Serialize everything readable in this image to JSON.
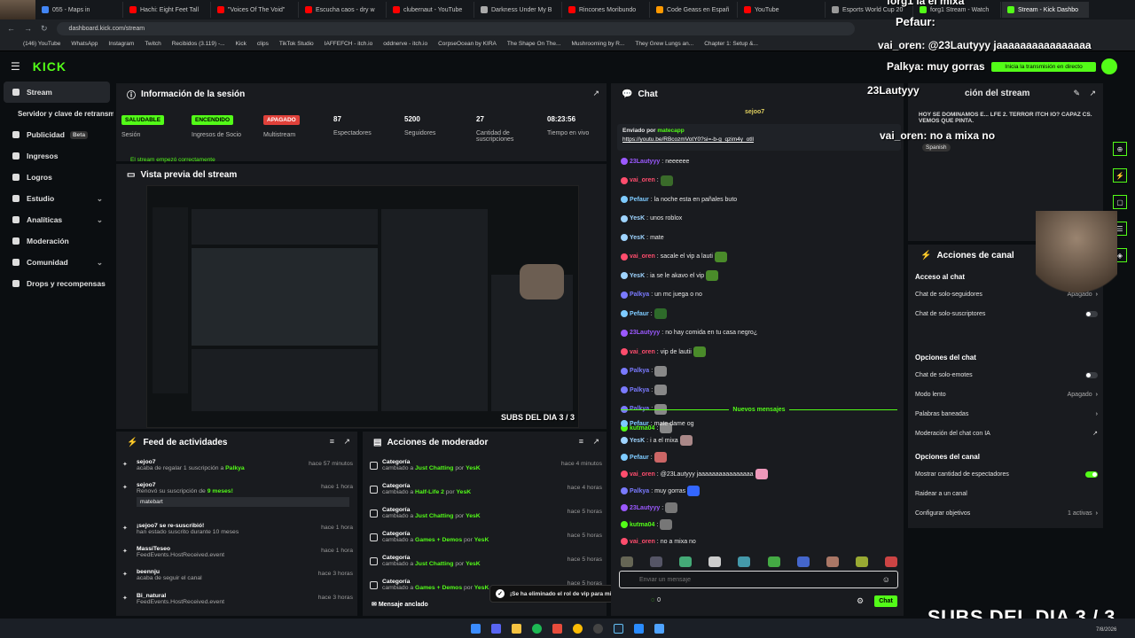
{
  "browser": {
    "tabs": [
      {
        "label": "055 - Maps in",
        "color": "#4285f4"
      },
      {
        "label": "Hachi: Eight Feet Tall",
        "color": "#f00"
      },
      {
        "label": "\"Voices Of The Void\"",
        "color": "#f00"
      },
      {
        "label": "Escucha caos - dry w",
        "color": "#f00"
      },
      {
        "label": "clubernaut - YouTube",
        "color": "#f00"
      },
      {
        "label": "Darkness Under My B",
        "color": "#aaa"
      },
      {
        "label": "Rincones Moribundo",
        "color": "#f00"
      },
      {
        "label": "Code Geass en Españ",
        "color": "#f90"
      },
      {
        "label": "YouTube",
        "color": "#f00"
      },
      {
        "label": "Esports World Cup 20",
        "color": "#999"
      },
      {
        "label": "forg1 Stream - Watch",
        "color": "#53fc18"
      },
      {
        "label": "Stream - Kick Dashbo",
        "color": "#53fc18"
      }
    ],
    "url": "dashboard.kick.com/stream",
    "bookmarks": [
      "(146) YouTube",
      "WhatsApp",
      "Instagram",
      "Twitch",
      "Recibidos (3.119) -...",
      "Kick",
      "clips",
      "TikTok Studio",
      "IAFFEFCH - itch.io",
      "oddnerve - itch.io",
      "CorpseOcean by KIRA",
      "The Shape On The...",
      "Mushrooming by R...",
      "They Grew Lungs an...",
      "Chapter 1: Setup &..."
    ]
  },
  "topnav": {
    "logo": "KICK",
    "stream_button": "Inicia la transmisión en directo"
  },
  "sidebar": [
    {
      "label": "Stream",
      "icon": "broadcast-icon",
      "active": true
    },
    {
      "label": "Servidor y clave de retransmisión",
      "icon": "",
      "active": false
    },
    {
      "label": "Publicidad",
      "icon": "megaphone-icon",
      "badge": "Beta"
    },
    {
      "label": "Ingresos",
      "icon": "dollar-icon"
    },
    {
      "label": "Logros",
      "icon": "trophy-icon"
    },
    {
      "label": "Estudio",
      "icon": "palette-icon",
      "chev": true
    },
    {
      "label": "Analíticas",
      "icon": "chart-icon",
      "chev": true
    },
    {
      "label": "Moderación",
      "icon": "shield-icon"
    },
    {
      "label": "Comunidad",
      "icon": "users-icon",
      "chev": true
    },
    {
      "label": "Drops y recompensas",
      "icon": "gift-icon"
    }
  ],
  "session": {
    "title": "Información de la sesión",
    "stats": [
      {
        "value": "SALUDABLE",
        "label": "Sesión",
        "badge": "#53fc18"
      },
      {
        "value": "ENCENDIDO",
        "label": "Ingresos de Socio",
        "badge": "#53fc18"
      },
      {
        "value": "APAGADO",
        "label": "Multistream",
        "badge": "#e0413a"
      },
      {
        "value": "87",
        "label": "Espectadores"
      },
      {
        "value": "5200",
        "label": "Seguidores"
      },
      {
        "value": "27",
        "label": "Cantidad de suscripciones"
      },
      {
        "value": "08:23:56",
        "label": "Tiempo en vivo"
      }
    ],
    "notice": "El stream empezó correctamente"
  },
  "preview": {
    "title": "Vista previa del stream",
    "overlay": "SUBS DEL DIA 3 / 3"
  },
  "feed": {
    "title": "Feed de actividades",
    "items": [
      {
        "name": "sejoo7",
        "desc": "acaba de regalar 1 suscripción a",
        "target": "Palkya",
        "time": "hace 57 minutos"
      },
      {
        "name": "sejoo7",
        "desc": "Renovó su suscripción de",
        "target": "9 meses!",
        "time": "hace 1 hora",
        "msg": "matebart"
      },
      {
        "name": "¡sejoo7 se re-suscribió!",
        "desc": "han estado suscrito durante 10 meses",
        "target": "",
        "time": "hace 1 hora"
      },
      {
        "name": "MassiTeseo",
        "desc": "FeedEvents.HostReceived.event",
        "target": "",
        "time": "hace 1 hora"
      },
      {
        "name": "beennju",
        "desc": "acaba de seguir el canal",
        "target": "",
        "time": "hace 3 horas"
      },
      {
        "name": "Bi_natural",
        "desc": "FeedEvents.HostReceived.event",
        "target": "",
        "time": "hace 3 horas"
      }
    ]
  },
  "modactions": {
    "title": "Acciones de moderador",
    "items": [
      {
        "label": "Categoría",
        "desc": "cambiado a",
        "value": "Just Chatting",
        "by": "YesK",
        "time": "hace 4 minutos"
      },
      {
        "label": "Categoría",
        "desc": "cambiado a",
        "value": "Half-Life 2",
        "by": "YesK",
        "time": "hace 4 horas"
      },
      {
        "label": "Categoría",
        "desc": "cambiado a",
        "value": "Just Chatting",
        "by": "YesK",
        "time": "hace 5 horas"
      },
      {
        "label": "Categoría",
        "desc": "cambiado a",
        "value": "Games + Demos",
        "by": "YesK",
        "time": "hace 5 horas"
      },
      {
        "label": "Categoría",
        "desc": "cambiado a",
        "value": "Just Chatting",
        "by": "YesK",
        "time": "hace 5 horas"
      },
      {
        "label": "Categoría",
        "desc": "cambiado a",
        "value": "Games + Demos",
        "by": "YesK",
        "time": "hace 5 horas"
      }
    ],
    "pinned": "Mensaje anclado",
    "toast": "¡Se ha eliminado el rol de vip para mixatp!"
  },
  "chat": {
    "title": "Chat",
    "pinned_user": "sejoo7",
    "sent_by": "Enviado por",
    "sent_by_user": "matecapp",
    "link": "https://youtu.be/RBcozmVotY0?si=-b-g_qzim4y_otll",
    "messages": [
      {
        "user": "23Lautyyy",
        "color": "#9b59ff",
        "text": "neeeeee"
      },
      {
        "user": "vai_oren",
        "color": "#ff4d6d",
        "text": "",
        "emote": "#3a6b2a"
      },
      {
        "user": "Pefaur",
        "color": "#7ecbff",
        "text": "la noche esta en pañales buto"
      },
      {
        "user": "YesK",
        "color": "#9fd4ff",
        "text": "unos roblox"
      },
      {
        "user": "YesK",
        "color": "#9fd4ff",
        "text": "mate"
      },
      {
        "user": "vai_oren",
        "color": "#ff4d6d",
        "text": "sacale el vip a lauti",
        "emote": "#4a8b2a"
      },
      {
        "user": "YesK",
        "color": "#9fd4ff",
        "text": "ia se le akavo el vip",
        "emote": "#4a8b2a"
      },
      {
        "user": "Palkya",
        "color": "#7a7aff",
        "text": "un mc juega o no"
      },
      {
        "user": "Pefaur",
        "color": "#7ecbff",
        "text": "",
        "emote": "#2e6b2a"
      },
      {
        "user": "23Lautyyy",
        "color": "#9b59ff",
        "text": "no hay comida en tu casa negro¿"
      },
      {
        "user": "vai_oren",
        "color": "#ff4d6d",
        "text": "vip de lautii",
        "emote": "#4a8b2a"
      },
      {
        "user": "Palkya",
        "color": "#7a7aff",
        "text": "",
        "emote": "#888"
      },
      {
        "user": "Palkya",
        "color": "#7a7aff",
        "text": "",
        "emote": "#888"
      },
      {
        "user": "Palkya",
        "color": "#7a7aff",
        "text": "",
        "emote": "#888"
      },
      {
        "user": "kutma04",
        "color": "#53fc18",
        "text": "",
        "emote": "#888"
      }
    ],
    "new_messages": "Nuevos mensajes",
    "new": [
      {
        "user": "Pefaur",
        "color": "#7ecbff",
        "text": "mate dame og"
      },
      {
        "user": "YesK",
        "color": "#9fd4ff",
        "text": "i a el mixa",
        "emote": "#a88"
      },
      {
        "user": "Pefaur",
        "color": "#7ecbff",
        "text": "",
        "emote": "#c66"
      },
      {
        "user": "vai_oren",
        "color": "#ff4d6d",
        "text": "@23Lautyyy jaaaaaaaaaaaaaaaa",
        "emote": "#e9b"
      },
      {
        "user": "Palkya",
        "color": "#7a7aff",
        "text": "muy gorras",
        "emote": "#36f"
      },
      {
        "user": "23Lautyyy",
        "color": "#9b59ff",
        "text": "",
        "emote": "#777"
      },
      {
        "user": "kutma04",
        "color": "#53fc18",
        "text": "",
        "emote": "#777"
      },
      {
        "user": "vai_oren",
        "color": "#ff4d6d",
        "text": "no a mixa no"
      }
    ],
    "input_placeholder": "Enviar un mensaje",
    "send_label": "Chat",
    "count": "0"
  },
  "channel": {
    "title": "Acciones de canal",
    "info_title": "ción del stream",
    "info_desc": "HOY SE DOMINAMOS E... LFE 2. TERROR ITCH IO? CAPAZ CS. VEMOS QUE PINTA.",
    "lang": "Spanish",
    "sections": [
      {
        "heading": "Acceso al chat",
        "rows": [
          {
            "label": "Chat de solo-seguidores",
            "value": "Apagado",
            "kind": "chev"
          },
          {
            "label": "Chat de solo-suscriptores",
            "value": "",
            "kind": "toggle",
            "on": false
          }
        ]
      },
      {
        "heading": "Opciones del chat",
        "rows": [
          {
            "label": "Chat de solo-emotes",
            "value": "",
            "kind": "toggle",
            "on": false
          },
          {
            "label": "Modo lento",
            "value": "Apagado",
            "kind": "chev"
          },
          {
            "label": "Palabras baneadas",
            "value": "",
            "kind": "chev"
          },
          {
            "label": "Moderación del chat con IA",
            "value": "",
            "kind": "ext"
          }
        ]
      },
      {
        "heading": "Opciones del canal",
        "rows": [
          {
            "label": "Mostrar cantidad de espectadores",
            "value": "",
            "kind": "toggle",
            "on": true
          },
          {
            "label": "Raidear a un canal",
            "value": "",
            "kind": "none"
          },
          {
            "label": "Configurar objetivos",
            "value": "1 activas",
            "kind": "chev"
          }
        ]
      }
    ]
  },
  "overlay": {
    "top_lines": [
      "Pefaur:",
      "vai_oren: @23Lautyyy jaaaaaaaaaaaaaaaa",
      "Palkya:  muy gorras",
      "23Lautyyy",
      "vai_oren: no a mixa no"
    ],
    "bottom": "SUBS DEL DIA 3 / 3",
    "top_right": "forg1 ia el mixa"
  },
  "clock": {
    "time": "",
    "date": "7/8/2026"
  }
}
